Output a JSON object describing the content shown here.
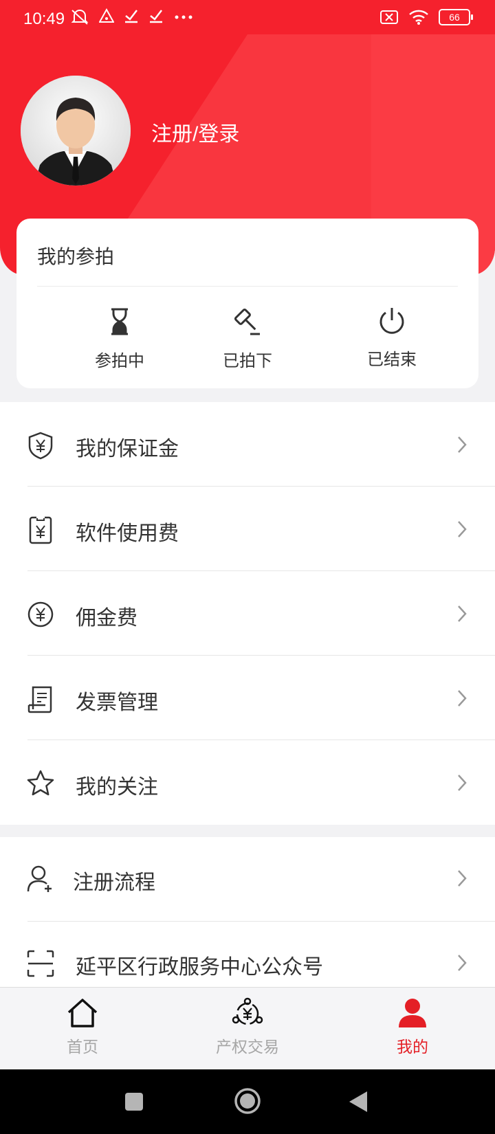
{
  "status_bar": {
    "time": "10:49",
    "battery": "66"
  },
  "profile": {
    "login_label": "注册/登录"
  },
  "my_bids": {
    "title": "我的参拍",
    "items": [
      {
        "label": "参拍中",
        "icon": "hourglass-icon"
      },
      {
        "label": "已拍下",
        "icon": "gavel-icon"
      },
      {
        "label": "已结束",
        "icon": "power-icon"
      }
    ]
  },
  "menu": {
    "group1": [
      {
        "label": "我的保证金",
        "icon": "shield-yen-icon"
      },
      {
        "label": "软件使用费",
        "icon": "receipt-yen-icon"
      },
      {
        "label": "佣金费",
        "icon": "coin-yen-icon"
      },
      {
        "label": "发票管理",
        "icon": "invoice-icon"
      },
      {
        "label": "我的关注",
        "icon": "star-icon"
      }
    ],
    "group2": [
      {
        "label": "注册流程",
        "icon": "add-user-icon"
      },
      {
        "label": "延平区行政服务中心公众号",
        "icon": "scan-icon"
      }
    ]
  },
  "tabbar": {
    "tabs": [
      {
        "label": "首页",
        "icon": "home-icon",
        "active": false
      },
      {
        "label": "产权交易",
        "icon": "trade-icon",
        "active": false
      },
      {
        "label": "我的",
        "icon": "user-icon",
        "active": true
      }
    ]
  },
  "colors": {
    "brand_red": "#f5212d",
    "active_tab": "#e41f26"
  }
}
